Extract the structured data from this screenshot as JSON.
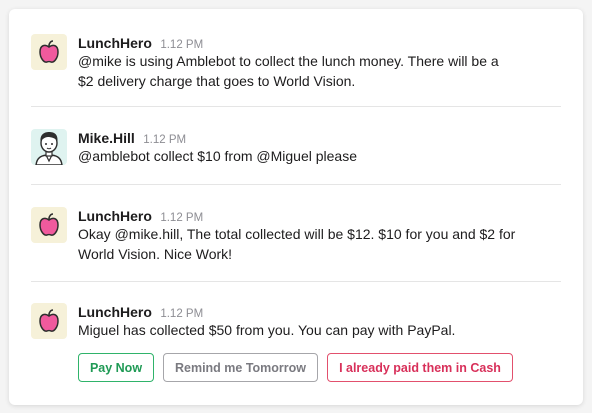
{
  "messages": [
    {
      "name": "LunchHero",
      "time": "1.12 PM",
      "avatar_icon": "apple-icon",
      "lines": [
        "@mike is using Amblebot to collect the lunch money. There will be a",
        "$2 delivery charge that goes to World Vision."
      ]
    },
    {
      "name": "Mike.Hill",
      "time": "1.12 PM",
      "avatar_icon": "user-avatar-icon",
      "lines": [
        "@amblebot collect $10 from @Miguel please"
      ]
    },
    {
      "name": "LunchHero",
      "time": "1.12 PM",
      "avatar_icon": "apple-icon",
      "lines": [
        "Okay @mike.hill, The total collected will be $12. $10 for you and $2 for",
        "World Vision. Nice Work!"
      ]
    },
    {
      "name": "LunchHero",
      "time": "1.12 PM",
      "avatar_icon": "apple-icon",
      "lines": [
        "Miguel has collected $50 from you. You can pay with PayPal."
      ]
    }
  ],
  "actions": {
    "pay_now": "Pay Now",
    "remind": "Remind me Tomorrow",
    "paid_cash": "I already paid them in Cash"
  },
  "colors": {
    "pay_green": "#2fb36a",
    "remind_gray": "#a6a6aa",
    "paid_red": "#e2506d",
    "apple_pink": "#f05a9d"
  }
}
